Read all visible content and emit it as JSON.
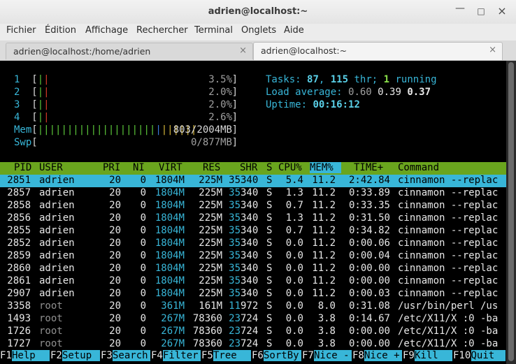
{
  "window": {
    "title": "adrien@localhost:~"
  },
  "menu": [
    "Fichier",
    "Édition",
    "Affichage",
    "Rechercher",
    "Terminal",
    "Onglets",
    "Aide"
  ],
  "tabs": [
    {
      "label": "adrien@localhost:/home/adrien",
      "active": false
    },
    {
      "label": "adrien@localhost:~",
      "active": true
    }
  ],
  "cpus": [
    {
      "id": "1",
      "percent": "3.5%"
    },
    {
      "id": "2",
      "percent": "2.0%"
    },
    {
      "id": "3",
      "percent": "2.0%"
    },
    {
      "id": "4",
      "percent": "2.6%"
    }
  ],
  "mem": {
    "label": "Mem",
    "value": "803/2004MB"
  },
  "swp": {
    "label": "Swp",
    "value": "0/877MB"
  },
  "tasks": {
    "label": "Tasks:",
    "count": "87",
    "thr": "115",
    "thr_label": "thr;",
    "running": "1",
    "running_label": "running"
  },
  "load": {
    "label": "Load average:",
    "l1": "0.60",
    "l5": "0.39",
    "l15": "0.37"
  },
  "uptime": {
    "label": "Uptime:",
    "value": "00:16:12"
  },
  "columns": [
    "PID",
    "USER",
    "PRI",
    "NI",
    "VIRT",
    "RES",
    "SHR",
    "S",
    "CPU%",
    "MEM%",
    "TIME+",
    "Command"
  ],
  "processes": [
    {
      "pid": "2851",
      "user": "adrien",
      "pri": "20",
      "ni": "0",
      "virt": "1804M",
      "res": "225M",
      "shr_a": "35",
      "shr_b": "340",
      "s": "S",
      "cpu": "5.4",
      "mem": "11.2",
      "time": "2:42.84",
      "cmd": "cinnamon --replac"
    },
    {
      "pid": "2857",
      "user": "adrien",
      "pri": "20",
      "ni": "0",
      "virt": "1804M",
      "res": "225M",
      "shr_a": "35",
      "shr_b": "340",
      "s": "S",
      "cpu": "1.3",
      "mem": "11.2",
      "time": "0:33.89",
      "cmd": "cinnamon --replac"
    },
    {
      "pid": "2858",
      "user": "adrien",
      "pri": "20",
      "ni": "0",
      "virt": "1804M",
      "res": "225M",
      "shr_a": "35",
      "shr_b": "340",
      "s": "S",
      "cpu": "0.7",
      "mem": "11.2",
      "time": "0:33.35",
      "cmd": "cinnamon --replac"
    },
    {
      "pid": "2856",
      "user": "adrien",
      "pri": "20",
      "ni": "0",
      "virt": "1804M",
      "res": "225M",
      "shr_a": "35",
      "shr_b": "340",
      "s": "S",
      "cpu": "1.3",
      "mem": "11.2",
      "time": "0:31.50",
      "cmd": "cinnamon --replac"
    },
    {
      "pid": "2855",
      "user": "adrien",
      "pri": "20",
      "ni": "0",
      "virt": "1804M",
      "res": "225M",
      "shr_a": "35",
      "shr_b": "340",
      "s": "S",
      "cpu": "0.7",
      "mem": "11.2",
      "time": "0:34.82",
      "cmd": "cinnamon --replac"
    },
    {
      "pid": "2852",
      "user": "adrien",
      "pri": "20",
      "ni": "0",
      "virt": "1804M",
      "res": "225M",
      "shr_a": "35",
      "shr_b": "340",
      "s": "S",
      "cpu": "0.0",
      "mem": "11.2",
      "time": "0:00.06",
      "cmd": "cinnamon --replac"
    },
    {
      "pid": "2859",
      "user": "adrien",
      "pri": "20",
      "ni": "0",
      "virt": "1804M",
      "res": "225M",
      "shr_a": "35",
      "shr_b": "340",
      "s": "S",
      "cpu": "0.0",
      "mem": "11.2",
      "time": "0:00.04",
      "cmd": "cinnamon --replac"
    },
    {
      "pid": "2860",
      "user": "adrien",
      "pri": "20",
      "ni": "0",
      "virt": "1804M",
      "res": "225M",
      "shr_a": "35",
      "shr_b": "340",
      "s": "S",
      "cpu": "0.0",
      "mem": "11.2",
      "time": "0:00.00",
      "cmd": "cinnamon --replac"
    },
    {
      "pid": "2861",
      "user": "adrien",
      "pri": "20",
      "ni": "0",
      "virt": "1804M",
      "res": "225M",
      "shr_a": "35",
      "shr_b": "340",
      "s": "S",
      "cpu": "0.0",
      "mem": "11.2",
      "time": "0:00.00",
      "cmd": "cinnamon --replac"
    },
    {
      "pid": "2907",
      "user": "adrien",
      "pri": "20",
      "ni": "0",
      "virt": "1804M",
      "res": "225M",
      "shr_a": "35",
      "shr_b": "340",
      "s": "S",
      "cpu": "0.0",
      "mem": "11.2",
      "time": "0:00.03",
      "cmd": "cinnamon --replac"
    },
    {
      "pid": "3358",
      "user": "root",
      "pri": "20",
      "ni": "0",
      "virt": "361M",
      "res": "161M",
      "shr_a": "11",
      "shr_b": "972",
      "s": "S",
      "cpu": "0.0",
      "mem": "8.0",
      "time": "0:31.08",
      "cmd": "/usr/bin/perl /us"
    },
    {
      "pid": "1493",
      "user": "root",
      "pri": "20",
      "ni": "0",
      "virt": "267M",
      "res": "78360",
      "shr_a": "23",
      "shr_b": "724",
      "s": "S",
      "cpu": "0.0",
      "mem": "3.8",
      "time": "0:14.67",
      "cmd": "/etc/X11/X :0 -ba"
    },
    {
      "pid": "1726",
      "user": "root",
      "pri": "20",
      "ni": "0",
      "virt": "267M",
      "res": "78360",
      "shr_a": "23",
      "shr_b": "724",
      "s": "S",
      "cpu": "0.0",
      "mem": "3.8",
      "time": "0:00.00",
      "cmd": "/etc/X11/X :0 -ba"
    },
    {
      "pid": "1727",
      "user": "root",
      "pri": "20",
      "ni": "0",
      "virt": "267M",
      "res": "78360",
      "shr_a": "23",
      "shr_b": "724",
      "s": "S",
      "cpu": "0.0",
      "mem": "3.8",
      "time": "0:00.00",
      "cmd": "/etc/X11/X :0 -ba"
    }
  ],
  "fkeys": [
    {
      "key": "F1",
      "label": "Help"
    },
    {
      "key": "F2",
      "label": "Setup"
    },
    {
      "key": "F3",
      "label": "Search"
    },
    {
      "key": "F4",
      "label": "Filter"
    },
    {
      "key": "F5",
      "label": "Tree"
    },
    {
      "key": "F6",
      "label": "SortBy"
    },
    {
      "key": "F7",
      "label": "Nice -"
    },
    {
      "key": "F8",
      "label": "Nice +"
    },
    {
      "key": "F9",
      "label": "Kill"
    },
    {
      "key": "F10",
      "label": "Quit"
    }
  ],
  "colors": {
    "cyan": "#38b6d8",
    "green_header": "#6aa51e",
    "terminal_bg": "#000000"
  }
}
